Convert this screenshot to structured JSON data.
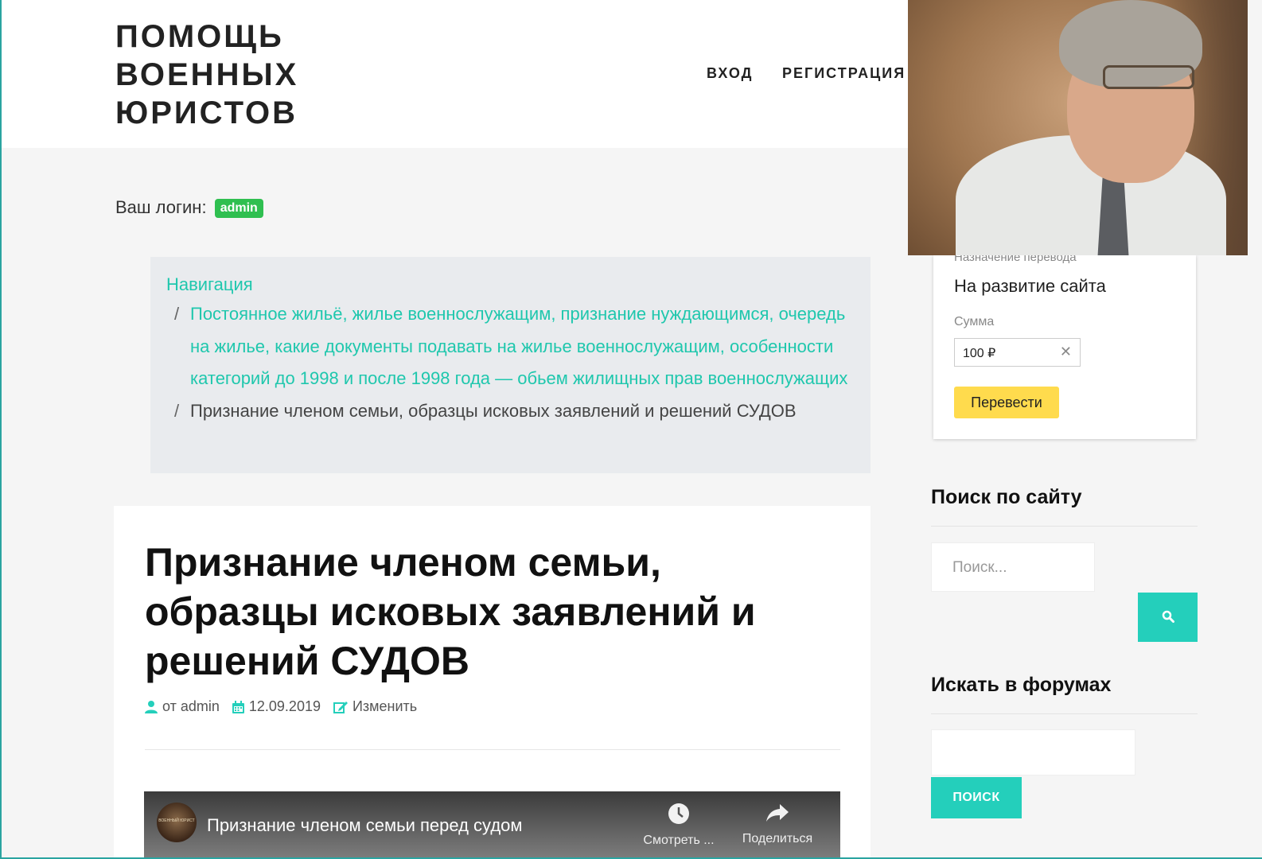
{
  "header": {
    "site_title_lines": [
      "ПОМОЩЬ",
      "ВОЕННЫХ",
      "ЮРИСТОВ"
    ],
    "nav": {
      "login": "ВХОД",
      "register": "РЕГИСТРАЦИЯ"
    }
  },
  "user": {
    "login_label": "Ваш логин:",
    "login": "admin"
  },
  "breadcrumb": {
    "root": "Навигация",
    "separator": "/",
    "parent": "Постоянное жильё, жилье военнослужащим, признание нуждающимся, очередь на жилье, какие документы подавать на жилье военнослужащим, особенности категорий до 1998 и после 1998 года — обьем жилищных прав военнослужащих",
    "current": "Признание членом семьи, образцы исковых заявлений и решений СУДОВ"
  },
  "article": {
    "title": "Признание членом семьи, образцы исковых заявлений и решений СУДОВ",
    "meta": {
      "author": "от admin",
      "date": "12.09.2019",
      "edit": "Изменить"
    },
    "video": {
      "title": "Признание членом семьи перед судом",
      "watch_label": "Смотреть ...",
      "share_label": "Поделиться",
      "logo_text": "ВОЕННЫЙ ЮРИСТ"
    }
  },
  "donate": {
    "purpose_label": "Назначение перевода",
    "purpose": "На развитие сайта",
    "sum_label": "Сумма",
    "sum_value": "100 ₽",
    "pay_button": "Перевести"
  },
  "sidebar": {
    "search_heading": "Поиск по сайту",
    "search_placeholder": "Поиск...",
    "forum_heading": "Искать в форумах",
    "forum_button": "ПОИСК"
  },
  "colors": {
    "accent": "#1fc7ad",
    "button_teal": "#24cfbb",
    "badge_green": "#2fbf50",
    "pay_yellow": "#ffdb4d"
  }
}
